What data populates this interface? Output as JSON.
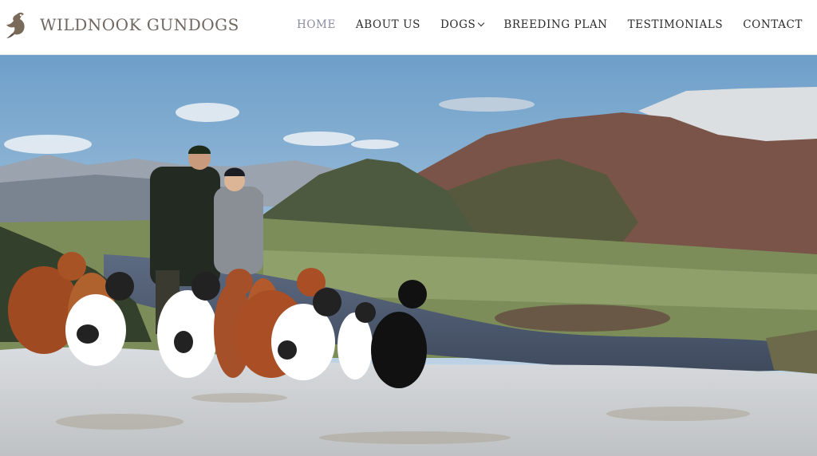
{
  "site": {
    "brand": "WILDNOOK GUNDOGS",
    "logo_icon": "pheasant-bird-icon"
  },
  "nav": {
    "items": [
      {
        "label": "HOME",
        "active": true
      },
      {
        "label": "ABOUT US",
        "active": false
      },
      {
        "label": "DOGS",
        "active": false,
        "has_dropdown": true
      },
      {
        "label": "BREEDING PLAN",
        "active": false
      },
      {
        "label": "TESTIMONIALS",
        "active": false
      },
      {
        "label": "CONTACT",
        "active": false
      }
    ]
  },
  "colors": {
    "active_nav": "#8a8aa0",
    "nav_text": "#2b2b2b",
    "brand_text": "#6f6760"
  }
}
